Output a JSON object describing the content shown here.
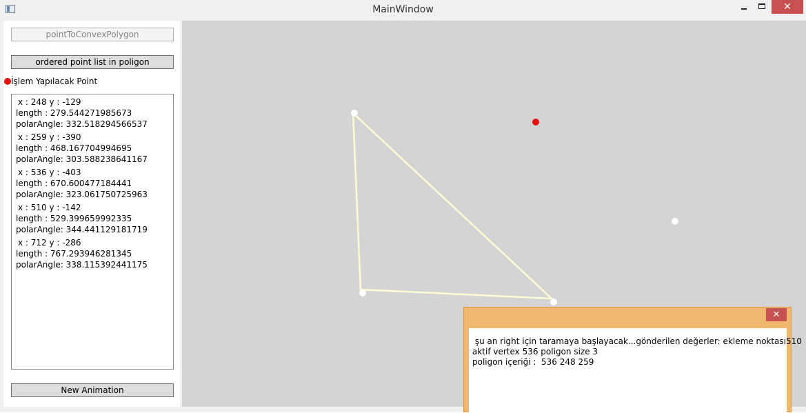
{
  "window": {
    "title": "MainWindow",
    "close_glyph": "✕"
  },
  "buttons": {
    "convex": "pointToConvexPolygon",
    "ordered": "ordered point list in poligon",
    "new_animation": "New Animation"
  },
  "point_label": "İşlem Yapılacak Point",
  "points_list": [
    {
      "xy": "x : 248 y : -129",
      "length": "length : 279.544271985673",
      "polar": "polarAngle: 332.518294566537"
    },
    {
      "xy": "x : 259 y : -390",
      "length": "length : 468.167704994695",
      "polar": "polarAngle: 303.588238641167"
    },
    {
      "xy": "x : 536 y : -403",
      "length": "length : 670.600477184441",
      "polar": "polarAngle: 323.061750725963"
    },
    {
      "xy": "x : 510 y : -142",
      "length": "length : 529.399659992335",
      "polar": "polarAngle: 344.441129181719"
    },
    {
      "xy": "x : 712 y : -286",
      "length": "length : 767.293946281345",
      "polar": "polarAngle: 338.115392441175"
    }
  ],
  "dialog": {
    "line1": " şu an right için taramaya başlayacak...gönderilen değerler: ekleme noktası510",
    "line2": "aktif vertex 536 poligon size 3",
    "line3": "poligon içeriği :  536 248 259",
    "close_glyph": "✕"
  },
  "colors": {
    "canvas_bg": "#d4d4d4",
    "polygon_stroke": "#fdfbd4",
    "point_fill": "#ffffff",
    "active_point": "#e81010",
    "dialog_frame": "#f0b86e"
  },
  "icons": [
    "app-icon",
    "minimize-icon",
    "maximize-icon",
    "close-icon",
    "red-dot-icon"
  ]
}
